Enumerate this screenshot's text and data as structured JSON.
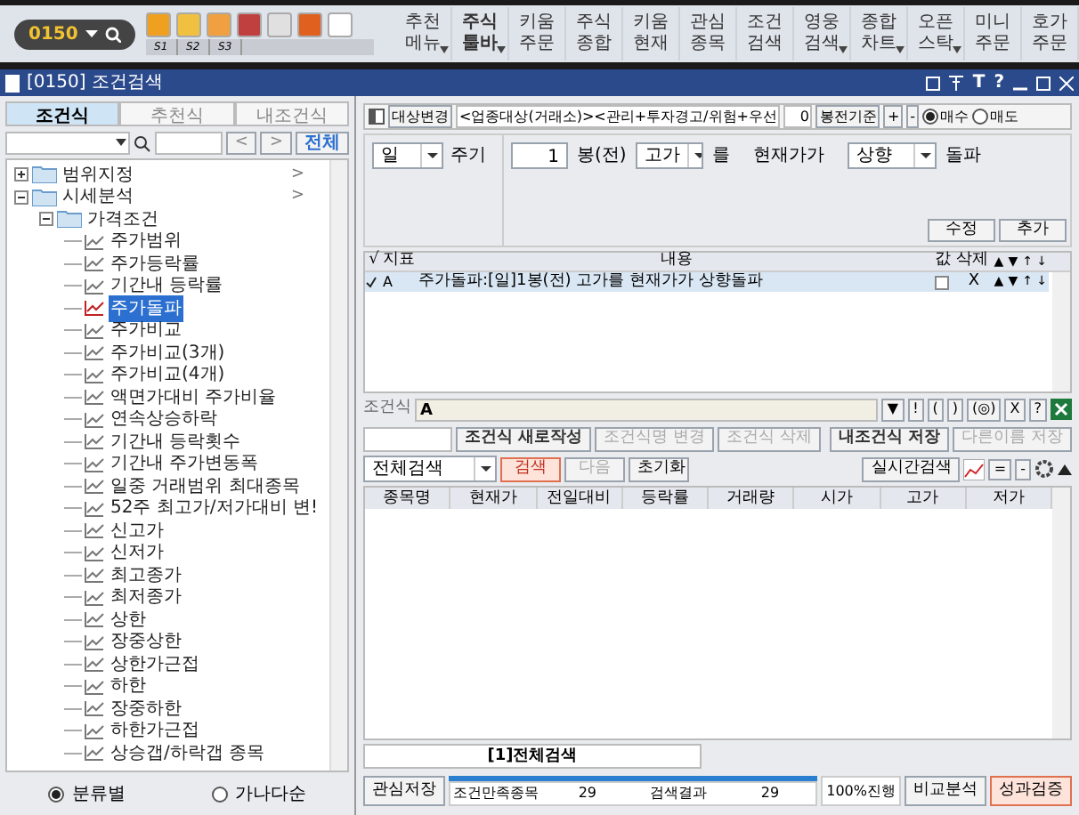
{
  "toolbar": {
    "screen_number": "0150",
    "shortcut_slots": [
      "S1",
      "S2",
      "S3"
    ],
    "menu_buttons": [
      {
        "lines": [
          "추천",
          "메뉴"
        ],
        "bold": false,
        "dropdown": true
      },
      {
        "lines": [
          "주식",
          "툴바"
        ],
        "bold": true,
        "dropdown": true
      },
      {
        "lines": [
          "키움",
          "주문"
        ],
        "bold": false,
        "dropdown": false
      },
      {
        "lines": [
          "주식",
          "종합"
        ],
        "bold": false,
        "dropdown": false
      },
      {
        "lines": [
          "키움",
          "현재"
        ],
        "bold": false,
        "dropdown": false
      },
      {
        "lines": [
          "관심",
          "종목"
        ],
        "bold": false,
        "dropdown": false
      },
      {
        "lines": [
          "조건",
          "검색"
        ],
        "bold": false,
        "dropdown": false
      },
      {
        "lines": [
          "영웅",
          "검색"
        ],
        "bold": false,
        "dropdown": true
      },
      {
        "lines": [
          "종합",
          "차트"
        ],
        "bold": false,
        "dropdown": true
      },
      {
        "lines": [
          "오픈",
          "스탁"
        ],
        "bold": false,
        "dropdown": true
      },
      {
        "lines": [
          "미니",
          "주문"
        ],
        "bold": false,
        "dropdown": false
      },
      {
        "lines": [
          "호가",
          "주문"
        ],
        "bold": false,
        "dropdown": false
      }
    ]
  },
  "window": {
    "title": "[0150] 조건검색",
    "controls": [
      "T",
      "?"
    ]
  },
  "left_panel": {
    "tabs": [
      {
        "label": "조건식",
        "selected": true
      },
      {
        "label": "추천식",
        "selected": false
      },
      {
        "label": "내조건식",
        "selected": false
      }
    ],
    "nav": [
      "<",
      ">"
    ],
    "all_button": "전체",
    "tree": [
      {
        "label": "범위지정",
        "arrow": ">",
        "expanded": false,
        "selected": false
      },
      {
        "label": "시세분석",
        "arrow": ">",
        "expanded": true,
        "selected": false,
        "children": [
          {
            "label": "가격조건",
            "expanded": true,
            "selected": false,
            "children": [
              {
                "label": "주가범위",
                "selected": false
              },
              {
                "label": "주가등락률",
                "selected": false
              },
              {
                "label": "기간내 등락률",
                "selected": false
              },
              {
                "label": "주가돌파",
                "selected": true
              },
              {
                "label": "주가비교",
                "selected": false
              },
              {
                "label": "주가비교(3개)",
                "selected": false
              },
              {
                "label": "주가비교(4개)",
                "selected": false
              },
              {
                "label": "액면가대비 주가비율",
                "selected": false
              },
              {
                "label": "연속상승하락",
                "selected": false
              },
              {
                "label": "기간내 등락횟수",
                "selected": false
              },
              {
                "label": "기간내 주가변동폭",
                "selected": false
              },
              {
                "label": "일중 거래범위 최대종목",
                "selected": false
              },
              {
                "label": "52주 최고가/저가대비 변!",
                "selected": false
              },
              {
                "label": "신고가",
                "selected": false
              },
              {
                "label": "신저가",
                "selected": false
              },
              {
                "label": "최고종가",
                "selected": false
              },
              {
                "label": "최저종가",
                "selected": false
              },
              {
                "label": "상한",
                "selected": false
              },
              {
                "label": "장중상한",
                "selected": false
              },
              {
                "label": "상한가근접",
                "selected": false
              },
              {
                "label": "하한",
                "selected": false
              },
              {
                "label": "장중하한",
                "selected": false
              },
              {
                "label": "하한가근접",
                "selected": false
              },
              {
                "label": "상승갭/하락갭 종목",
                "selected": false
              }
            ]
          }
        ]
      }
    ],
    "sort_options": [
      {
        "label": "분류별",
        "selected": true
      },
      {
        "label": "가나다순",
        "selected": false
      }
    ]
  },
  "target": {
    "button": "대상변경",
    "value": "<업종대상(거래소)><관리+투자경고/위험+우선",
    "count": "0",
    "basis_button": "봉전기준",
    "plus": "+",
    "minus": "-",
    "sides": [
      {
        "label": "매수",
        "selected": true
      },
      {
        "label": "매도",
        "selected": false
      }
    ]
  },
  "condition": {
    "period": "일",
    "period_label": "주기",
    "bars": "1",
    "bars_label": "봉(전)",
    "price": "고가",
    "price_label": "를",
    "current_label": "현재가가",
    "direction": "상향",
    "direction_label": "돌파",
    "buttons": [
      "수정",
      "추가"
    ]
  },
  "index_table": {
    "check_header": "√",
    "columns": [
      "지표",
      "내용",
      "값",
      "삭제"
    ],
    "arrows": [
      "▲",
      "▼",
      "↑",
      "↓"
    ],
    "rows": [
      {
        "checked": true,
        "index": "A",
        "content": "주가돌파:[일]1봉(전) 고가를 현재가가 상향돌파",
        "value_checked": false,
        "delete": "X",
        "arrows": [
          "▲",
          "▼",
          "↑",
          "↓"
        ]
      }
    ]
  },
  "formula": {
    "label": "조건식",
    "value": "A",
    "tools": [
      "▼",
      "!",
      "(",
      ")",
      "(◎)",
      "X",
      "?"
    ]
  },
  "formula_buttons": [
    {
      "label": "조건식 새로작성",
      "disabled": false
    },
    {
      "label": "조건식명 변경",
      "disabled": true
    },
    {
      "label": "조건식 삭제",
      "disabled": true
    },
    {
      "label": "내조건식 저장",
      "disabled": false
    },
    {
      "label": "다른이름 저장",
      "disabled": true
    }
  ],
  "search_bar": {
    "scope": "전체검색",
    "buttons": [
      {
        "label": "검색",
        "highlighted": true,
        "disabled": false
      },
      {
        "label": "다음",
        "highlighted": false,
        "disabled": true
      },
      {
        "label": "초기화",
        "highlighted": false,
        "disabled": false
      }
    ],
    "realtime_button": "실시간검색",
    "tools": [
      "=",
      "-"
    ]
  },
  "results": {
    "columns": [
      "종목명",
      "현재가",
      "전일대비",
      "등락률",
      "거래량",
      "시가",
      "고가",
      "저가"
    ],
    "tabs": [
      {
        "label": "[1]전체검색",
        "selected": true
      }
    ]
  },
  "status_bar": {
    "save_button": "관심저장",
    "met_label": "조건만족종목",
    "met": "29",
    "result_label": "검색결과",
    "result": "29",
    "progress_label": "100%진행",
    "level": 1,
    "compare_button": "비교분석",
    "verify_button": "성과검증"
  }
}
